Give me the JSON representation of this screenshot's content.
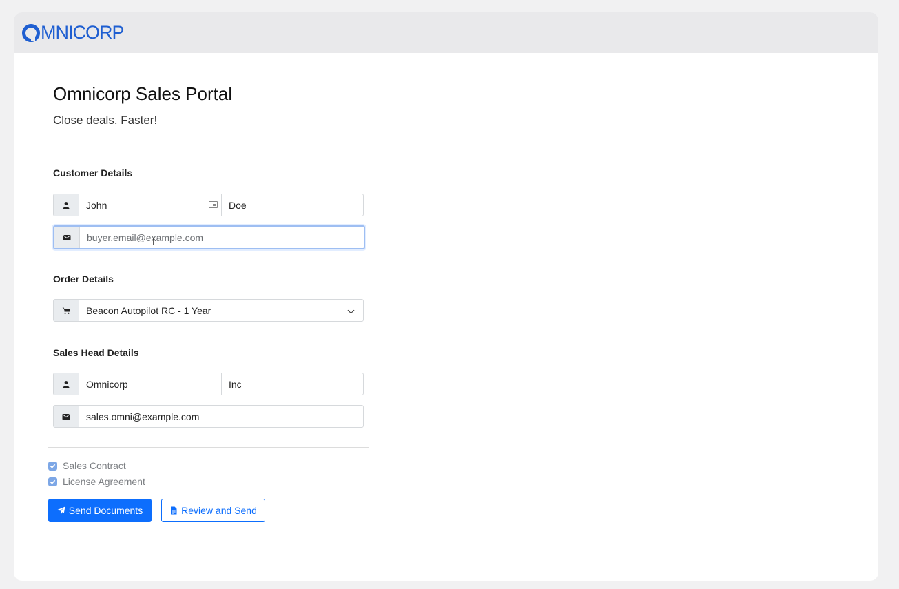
{
  "brand": {
    "logo_text": "MNICORP",
    "logo_letter": "O",
    "color": "#1f5fd1"
  },
  "header": {
    "title": "Omnicorp Sales Portal",
    "subtitle": "Close deals. Faster!"
  },
  "customer": {
    "section_label": "Customer Details",
    "first_name": "John",
    "last_name": "Doe",
    "email_placeholder": "buyer.email@example.com"
  },
  "order": {
    "section_label": "Order Details",
    "selected_product": "Beacon Autopilot RC - 1 Year"
  },
  "sales_head": {
    "section_label": "Sales Head Details",
    "first_name": "Omnicorp",
    "last_name": "Inc",
    "email": "sales.omni@example.com"
  },
  "documents": [
    {
      "label": "Sales Contract",
      "checked": true
    },
    {
      "label": "License Agreement",
      "checked": true
    }
  ],
  "actions": {
    "send_label": "Send Documents",
    "review_label": "Review and Send"
  },
  "icons": {
    "user": "user-icon",
    "mail": "envelope-icon",
    "cart": "cart-icon",
    "send": "paper-plane-icon",
    "document": "file-icon"
  },
  "colors": {
    "primary": "#0d6efd",
    "checkbox": "#7da7e6",
    "page_bg": "#f1f1f2"
  }
}
